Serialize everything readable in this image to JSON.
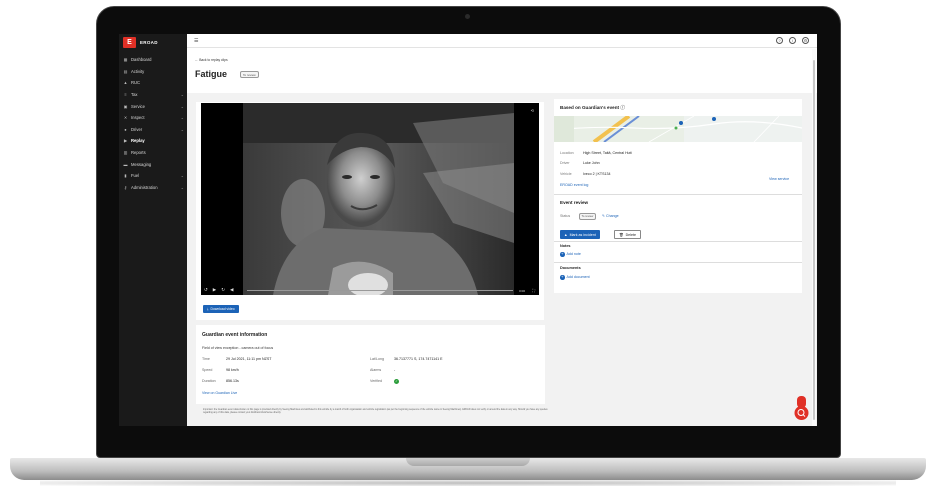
{
  "brand": {
    "name": "EROAD",
    "accent": "#e03026",
    "link_color": "#1c63b7"
  },
  "sidebar": {
    "items": [
      {
        "label": "Dashboard",
        "icon": "grid-icon",
        "chevron": false,
        "active": false
      },
      {
        "label": "Activity",
        "icon": "list-icon",
        "chevron": false,
        "active": false
      },
      {
        "label": "RUC",
        "icon": "road-icon",
        "chevron": false,
        "active": false
      },
      {
        "label": "Tax",
        "icon": "tax-icon",
        "chevron": true,
        "active": false
      },
      {
        "label": "Service",
        "icon": "service-icon",
        "chevron": true,
        "active": false
      },
      {
        "label": "Inspect",
        "icon": "wrench-icon",
        "chevron": true,
        "active": false
      },
      {
        "label": "Driver",
        "icon": "person-icon",
        "chevron": true,
        "active": false
      },
      {
        "label": "Replay",
        "icon": "replay-icon",
        "chevron": false,
        "active": true
      },
      {
        "label": "Reports",
        "icon": "report-icon",
        "chevron": false,
        "active": false
      },
      {
        "label": "Messaging",
        "icon": "message-icon",
        "chevron": false,
        "active": false
      },
      {
        "label": "Fuel",
        "icon": "fuel-icon",
        "chevron": true,
        "active": false
      },
      {
        "label": "Administration",
        "icon": "key-icon",
        "chevron": true,
        "active": false
      }
    ]
  },
  "topbar": {
    "icons": [
      "help-icon",
      "info-icon",
      "settings-icon"
    ]
  },
  "header": {
    "back_label": "Back to replay clips",
    "title": "Fatigue",
    "status_badge": "To review"
  },
  "video": {
    "time_display": "0:00",
    "download_label": "Download video"
  },
  "guardian_info": {
    "title": "Guardian event information",
    "subtitle": "Field of view exception - camera out of focus",
    "left_fields": [
      {
        "label": "Time",
        "value": "29 Jul 2021, 11:11 pm NZST"
      },
      {
        "label": "Speed",
        "value": "98 km/h"
      },
      {
        "label": "Duration",
        "value": "856.13s"
      }
    ],
    "right_fields": [
      {
        "label": "Lat/Long",
        "value": "36.7137771 S, 174.7471141 E"
      },
      {
        "label": "Alarms",
        "value": "-"
      },
      {
        "label": "Verified",
        "value": ""
      }
    ],
    "link_label": "View on Guardian Live"
  },
  "footnote": {
    "text": "Important: the Guardian event data shown on this page is provided directly by Seeing Machines and attributed to this vehicle by a match of both organisation and vehicle registration (as per the beginning sequence of the vehicle name in Seeing Machines). EROAD does not verify or amend the data in any way. Should you have any queries regarding any of this data, please contact your distributor/AutoSense directly."
  },
  "event_panel": {
    "title": "Based on Guardian's event",
    "fields": [
      {
        "label": "Location",
        "value": "High Street, Taitā, Central Hutt"
      },
      {
        "label": "Driver",
        "value": "Luke John"
      },
      {
        "label": "Vehicle",
        "value": "Iveco 2 | KTS134"
      }
    ],
    "event_log_label": "EROAD event log",
    "view_service_label": "View service",
    "review": {
      "title": "Event review",
      "status_label": "Status",
      "status_value": "To review",
      "change_label": "Change",
      "mark_incident_label": "Mark as incident",
      "delete_label": "Delete"
    },
    "notes": {
      "title": "Notes",
      "add_label": "Add note"
    },
    "documents": {
      "title": "Documents",
      "add_label": "Add document"
    }
  }
}
